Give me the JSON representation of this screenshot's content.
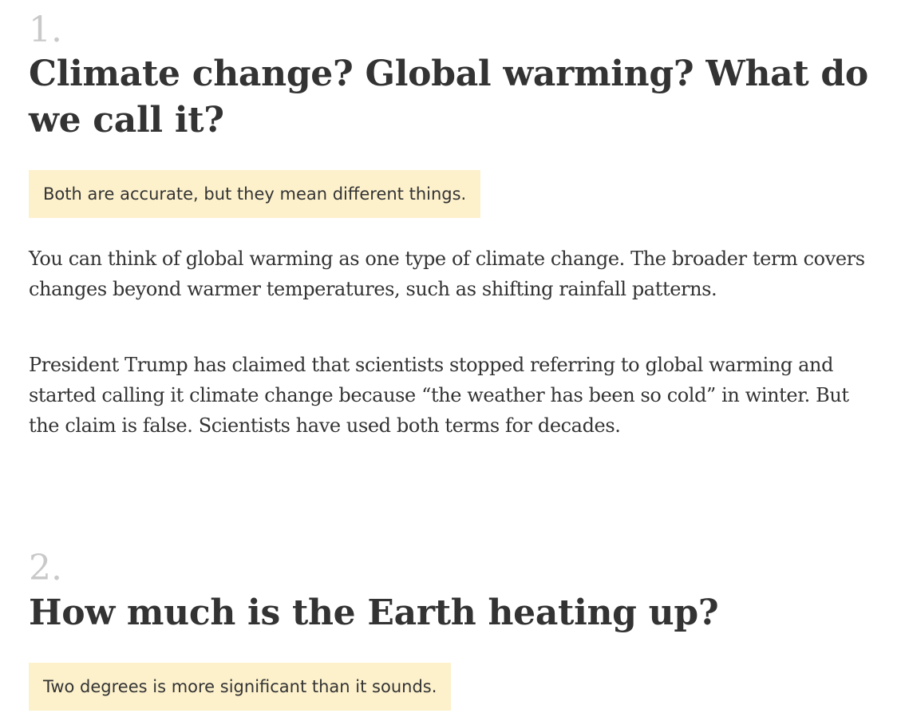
{
  "questions": [
    {
      "number": "1.",
      "title": "Climate change? Global warming? What do we call it?",
      "answer": "Both are accurate, but they mean different things.",
      "paragraphs": [
        "You can think of global warming as one type of climate change. The broader term covers changes beyond warmer temperatures, such as shifting rainfall patterns.",
        "President Trump has claimed that scientists stopped referring to global warming and started calling it climate change because “the weather has been so cold” in winter. But the claim is false. Scientists have used both terms for decades."
      ]
    },
    {
      "number": "2.",
      "title": "How much is the Earth heating up?",
      "answer": "Two degrees is more significant than it sounds."
    }
  ],
  "colors": {
    "number": "#c9c9c9",
    "text": "#333333",
    "answer_highlight": "#fdf1cc",
    "background": "#ffffff"
  }
}
